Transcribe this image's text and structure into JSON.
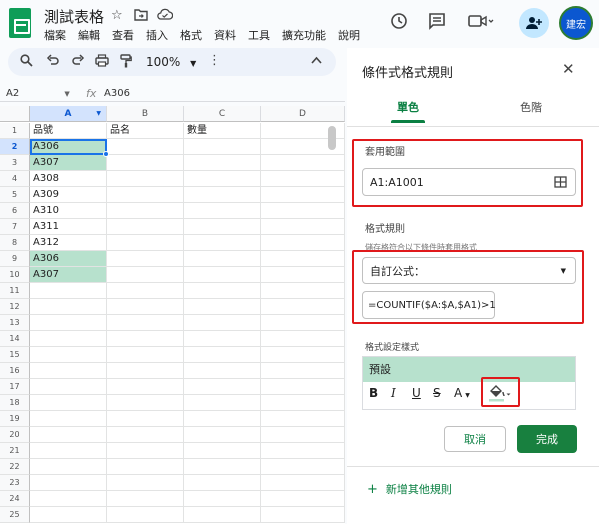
{
  "app": {
    "title": "測試表格",
    "menu": [
      "檔案",
      "編輯",
      "查看",
      "插入",
      "格式",
      "資料",
      "工具",
      "擴充功能",
      "說明"
    ],
    "avatar_text": "建宏",
    "accent": "#0b8043",
    "highlight_color": "#b7e1cd"
  },
  "icons": [
    "star-icon",
    "move-to-folder-icon",
    "cloud-status-icon",
    "history-icon",
    "comment-icon",
    "video-call-icon",
    "share-icon"
  ],
  "toolbar": {
    "zoom": "100%"
  },
  "formula_bar": {
    "name_box": "A2",
    "fx": "fx",
    "value": "A306"
  },
  "sheet": {
    "columns": [
      "A",
      "B",
      "C",
      "D"
    ],
    "rows": [
      {
        "num": "1",
        "a": "品號",
        "b": "品名",
        "c": "數量",
        "hl": false
      },
      {
        "num": "2",
        "a": "A306",
        "b": "",
        "c": "",
        "hl": true
      },
      {
        "num": "3",
        "a": "A307",
        "b": "",
        "c": "",
        "hl": true
      },
      {
        "num": "4",
        "a": "A308",
        "b": "",
        "c": "",
        "hl": false
      },
      {
        "num": "5",
        "a": "A309",
        "b": "",
        "c": "",
        "hl": false
      },
      {
        "num": "6",
        "a": "A310",
        "b": "",
        "c": "",
        "hl": false
      },
      {
        "num": "7",
        "a": "A311",
        "b": "",
        "c": "",
        "hl": false
      },
      {
        "num": "8",
        "a": "A312",
        "b": "",
        "c": "",
        "hl": false
      },
      {
        "num": "9",
        "a": "A306",
        "b": "",
        "c": "",
        "hl": true
      },
      {
        "num": "10",
        "a": "A307",
        "b": "",
        "c": "",
        "hl": true
      },
      {
        "num": "11",
        "a": "",
        "b": "",
        "c": "",
        "hl": false
      },
      {
        "num": "12",
        "a": "",
        "b": "",
        "c": "",
        "hl": false
      },
      {
        "num": "13",
        "a": "",
        "b": "",
        "c": "",
        "hl": false
      },
      {
        "num": "14",
        "a": "",
        "b": "",
        "c": "",
        "hl": false
      },
      {
        "num": "15",
        "a": "",
        "b": "",
        "c": "",
        "hl": false
      },
      {
        "num": "16",
        "a": "",
        "b": "",
        "c": "",
        "hl": false
      },
      {
        "num": "17",
        "a": "",
        "b": "",
        "c": "",
        "hl": false
      },
      {
        "num": "18",
        "a": "",
        "b": "",
        "c": "",
        "hl": false
      },
      {
        "num": "19",
        "a": "",
        "b": "",
        "c": "",
        "hl": false
      },
      {
        "num": "20",
        "a": "",
        "b": "",
        "c": "",
        "hl": false
      },
      {
        "num": "21",
        "a": "",
        "b": "",
        "c": "",
        "hl": false
      },
      {
        "num": "22",
        "a": "",
        "b": "",
        "c": "",
        "hl": false
      },
      {
        "num": "23",
        "a": "",
        "b": "",
        "c": "",
        "hl": false
      },
      {
        "num": "24",
        "a": "",
        "b": "",
        "c": "",
        "hl": false
      },
      {
        "num": "25",
        "a": "",
        "b": "",
        "c": "",
        "hl": false
      }
    ]
  },
  "panel": {
    "title": "條件式格式規則",
    "tab_single": "單色",
    "tab_scale": "色階",
    "range_label": "套用範圍",
    "range_value": "A1:A1001",
    "rules_label": "格式規則",
    "rules_hint": "儲存格符合以下條件時套用格式",
    "condition": "自訂公式：",
    "formula": "=COUNTIF($A:$A,$A1)>1",
    "style_label": "格式設定樣式",
    "style_preview": "預設",
    "cancel": "取消",
    "done": "完成",
    "add_rule": "新增其他規則"
  }
}
